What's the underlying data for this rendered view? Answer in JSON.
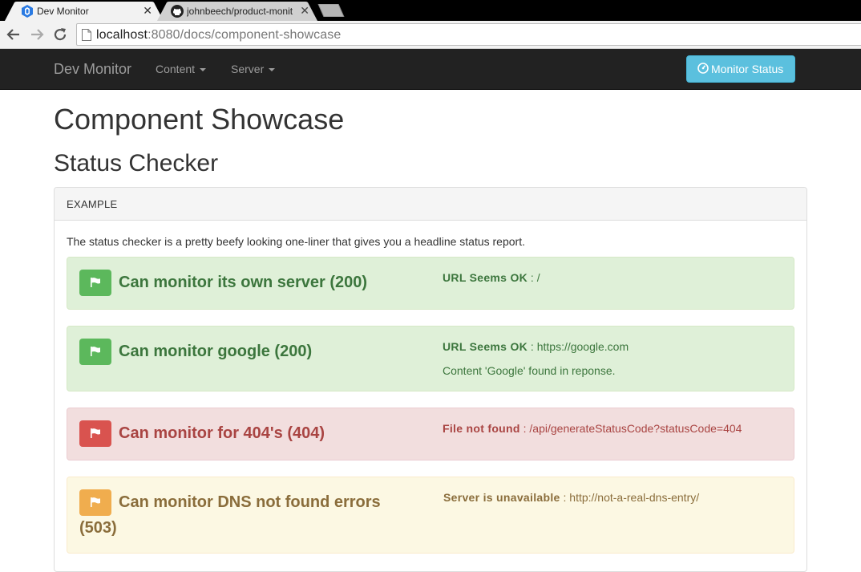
{
  "browser": {
    "tabs": [
      {
        "title": "Dev Monitor",
        "active": true
      },
      {
        "title": "johnbeech/product-monit",
        "active": false
      }
    ],
    "url_host": "localhost",
    "url_rest": ":8080/docs/component-showcase"
  },
  "navbar": {
    "brand": "Dev Monitor",
    "menus": [
      "Content",
      "Server"
    ],
    "button_label": "Monitor Status",
    "colors": {
      "background": "#222222",
      "link": "#9d9d9d",
      "button": "#5bc0de"
    }
  },
  "page": {
    "title": "Component Showcase",
    "section_title": "Status Checker",
    "panel_heading": "EXAMPLE",
    "intro": "The status checker is a pretty beefy looking one-liner that gives you a headline status report."
  },
  "statuses": [
    {
      "state": "success",
      "headline": "Can monitor its own server (200)",
      "lines": [
        {
          "label": "URL Seems OK",
          "text": " : /"
        }
      ]
    },
    {
      "state": "success",
      "headline": "Can monitor google (200)",
      "lines": [
        {
          "label": "URL Seems OK",
          "text": " : https://google.com"
        },
        {
          "label": "",
          "text": "Content 'Google' found in reponse."
        }
      ]
    },
    {
      "state": "danger",
      "headline": "Can monitor for 404's (404)",
      "lines": [
        {
          "label": "File not found",
          "text": " : /api/generateStatusCode?statusCode=404"
        }
      ]
    },
    {
      "state": "warning",
      "headline_part1": "Can monitor DNS not found errors",
      "headline_part2": "(503)",
      "lines": [
        {
          "label": "Server is unavailable",
          "text": " : http://not-a-real-dns-entry/"
        }
      ]
    }
  ],
  "icons": {
    "tab1": "dev-monitor-favicon",
    "tab2": "github-icon",
    "status": "flag-icon",
    "button": "dashboard-icon"
  }
}
